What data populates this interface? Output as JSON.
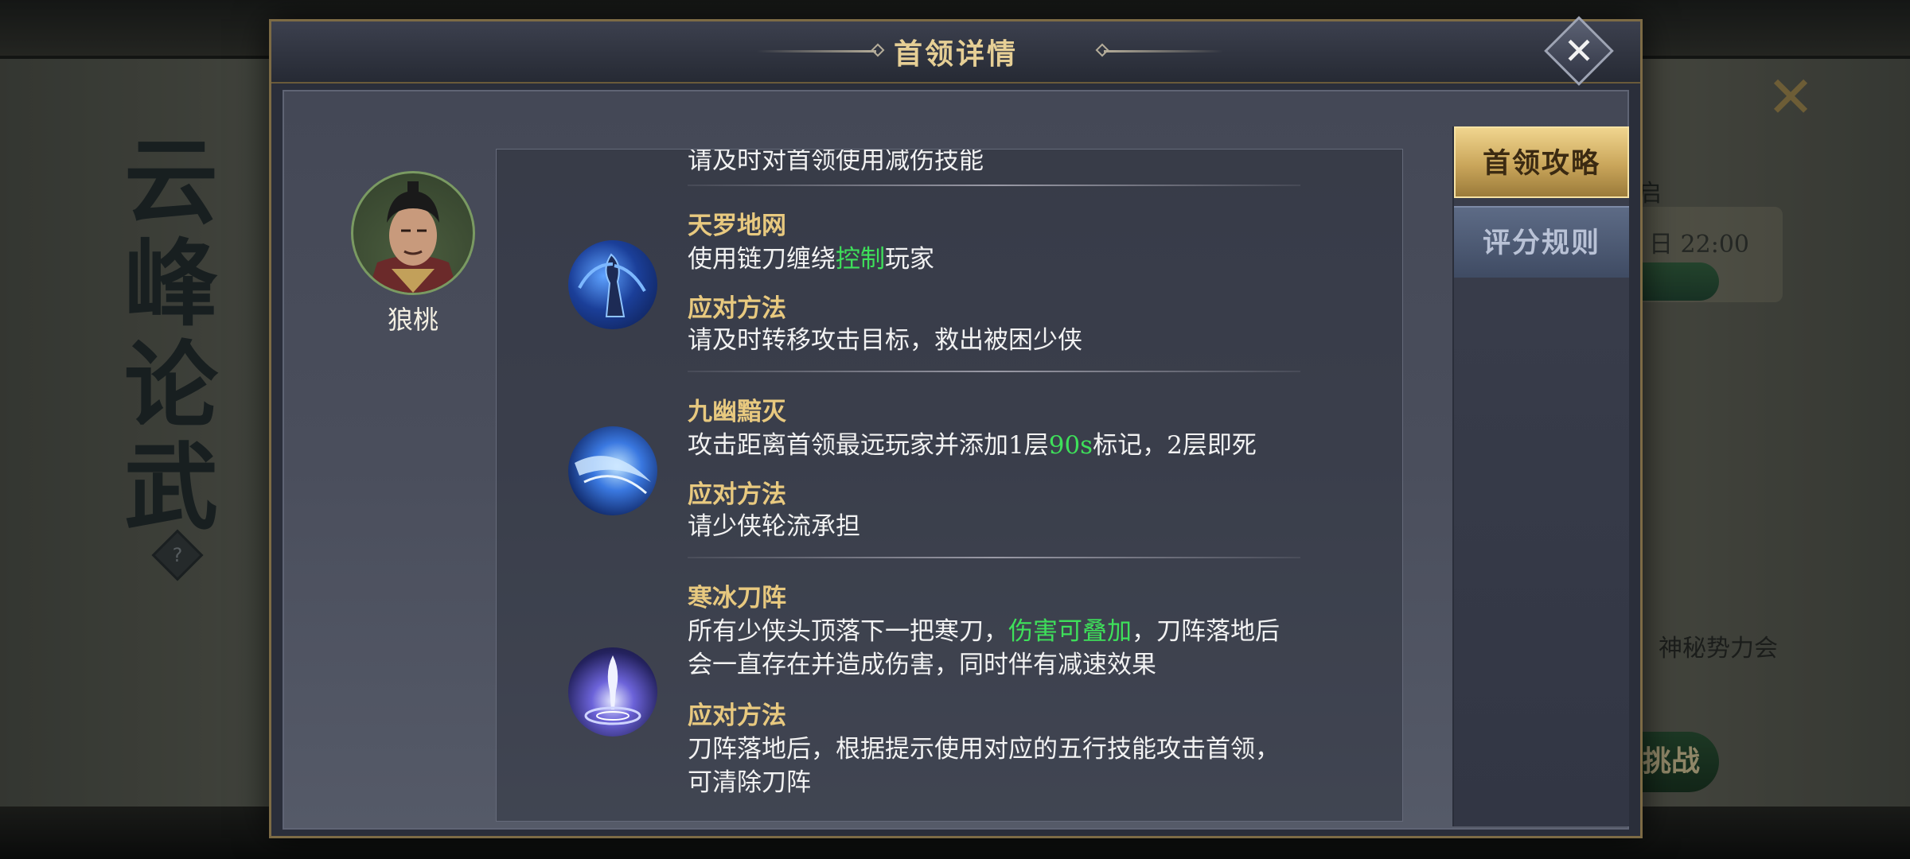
{
  "background": {
    "title_chars": [
      "云",
      "峰",
      "论",
      "武"
    ],
    "help_label": "?",
    "close_label": "✕",
    "time_text": "日 22:00",
    "open_text": "启",
    "faction_text": "神秘势力会",
    "challenge_btn": "挑战"
  },
  "dialog": {
    "title": "首领详情",
    "close_label": "✕"
  },
  "boss": {
    "name": "狼桃"
  },
  "skills": {
    "prev_counter": "请及时对首领使用减伤技能",
    "items": [
      {
        "icon": "chain-blade-skill-icon",
        "name": "天罗地网",
        "desc_pre": "使用链刀缠绕",
        "desc_hl": "控制",
        "desc_post": "玩家",
        "counter_head": "应对方法",
        "counter": "请及时转移攻击目标，救出被困少侠"
      },
      {
        "icon": "blue-slash-skill-icon",
        "name": "九幽黯灭",
        "desc_pre": "攻击距离首领最远玩家并添加1层",
        "desc_hl": "90s",
        "desc_post": "标记，2层即死",
        "counter_head": "应对方法",
        "counter": "请少侠轮流承担"
      },
      {
        "icon": "ice-blade-array-skill-icon",
        "name": "寒冰刀阵",
        "desc_pre": "所有少侠头顶落下一把寒刀，",
        "desc_hl": "伤害可叠加",
        "desc_post": "，刀阵落地后",
        "desc_line2": "会一直存在并造成伤害，同时伴有减速效果",
        "counter_head": "应对方法",
        "counter": "刀阵落地后，根据提示使用对应的五行技能攻击首领，",
        "counter_line2": "可清除刀阵"
      }
    ]
  },
  "tabs": [
    {
      "label": "首领攻略",
      "active": true
    },
    {
      "label": "评分规则",
      "active": false
    }
  ],
  "colors": {
    "gold": "#e8c97f",
    "highlight_green": "#3ee05a",
    "text_white": "#f2f2f2"
  }
}
